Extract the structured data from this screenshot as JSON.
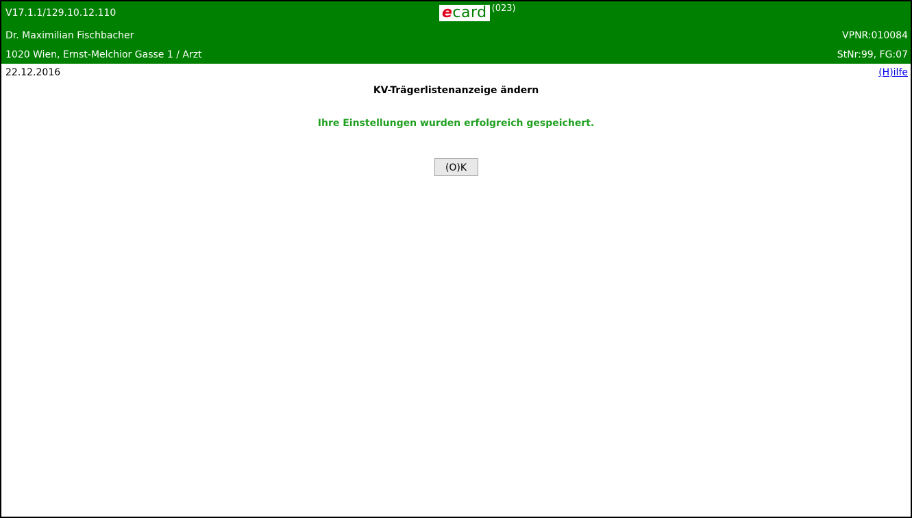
{
  "header": {
    "version": "V17.1.1/129.10.12.110",
    "logo": {
      "e": "e",
      "card": "card",
      "suffix": "(023)"
    },
    "doctor_name": "Dr. Maximilian Fischbacher",
    "vpnr": "VPNR:010084",
    "address": "1020 Wien, Ernst-Melchior Gasse 1 / Arzt",
    "stnr": "StNr:99, FG:07"
  },
  "toolbar": {
    "date": "22.12.2016",
    "help_label": "(H)ilfe"
  },
  "main": {
    "title": "KV-Trägerlistenanzeige ändern",
    "success_message": "Ihre Einstellungen wurden erfolgreich gespeichert.",
    "ok_label": "(O)K"
  },
  "colors": {
    "header_bg": "#008000",
    "success_text": "#20a020",
    "logo_e": "#e0001a",
    "link": "#0000ee"
  }
}
